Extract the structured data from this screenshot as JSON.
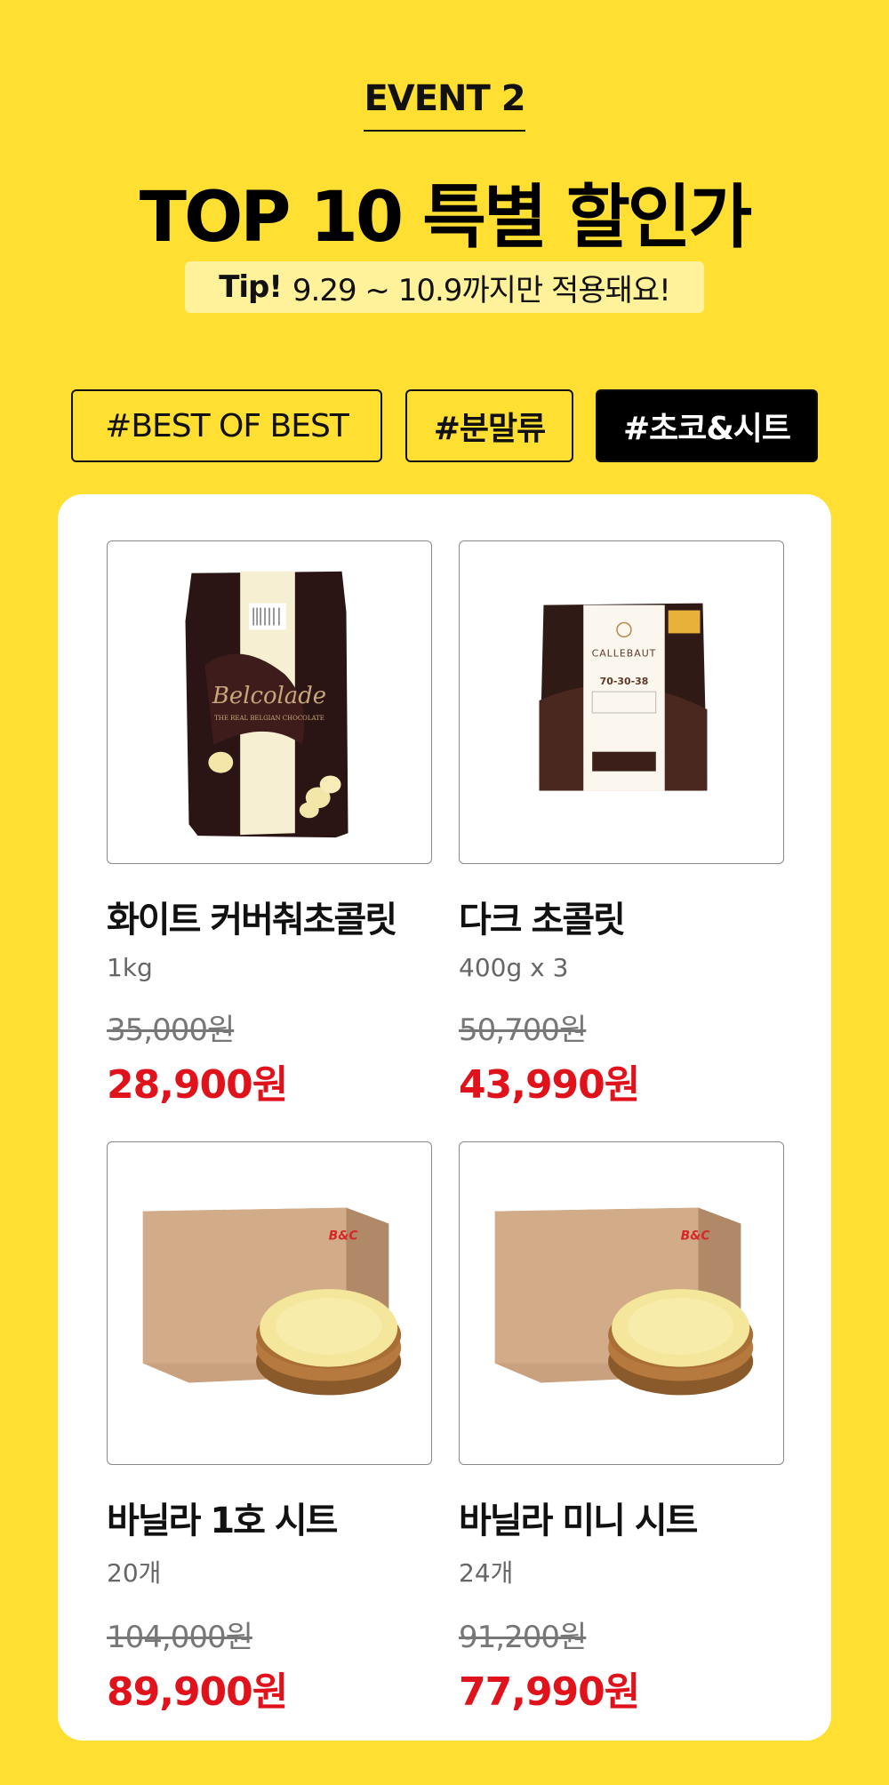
{
  "header": {
    "event_label": "EVENT 2",
    "title": "TOP 10 특별 할인가",
    "tip_label": "Tip!",
    "tip_text": "9.29 ~ 10.9까지만 적용돼요!"
  },
  "tabs": [
    {
      "label": "#BEST OF BEST",
      "active": false
    },
    {
      "label": "#분말류",
      "active": false
    },
    {
      "label": "#초코&시트",
      "active": true
    }
  ],
  "products": [
    {
      "name": "화이트 커버춰초콜릿",
      "qty": "1kg",
      "old_price": "35,000원",
      "price": "28,900원",
      "image": "belcolade-white-chocolate-bag",
      "brand": "Belcolade",
      "brand_sub": "THE REAL BELGIAN CHOCOLATE"
    },
    {
      "name": "다크 초콜릿",
      "qty": "400g x 3",
      "old_price": "50,700원",
      "price": "43,990원",
      "image": "callebaut-dark-callets-bag",
      "brand": "CALLEBAUT",
      "brand_sub": "70-30-38"
    },
    {
      "name": "바닐라 1호 시트",
      "qty": "20개",
      "old_price": "104,000원",
      "price": "89,900원",
      "image": "box-with-sponge-sheet",
      "brand": "B&C"
    },
    {
      "name": "바닐라 미니 시트",
      "qty": "24개",
      "old_price": "91,200원",
      "price": "77,990원",
      "image": "box-with-sponge-sheet",
      "brand": "B&C"
    }
  ],
  "colors": {
    "background": "#FFDF32",
    "price_red": "#E0121C",
    "tab_active": "#000000"
  }
}
